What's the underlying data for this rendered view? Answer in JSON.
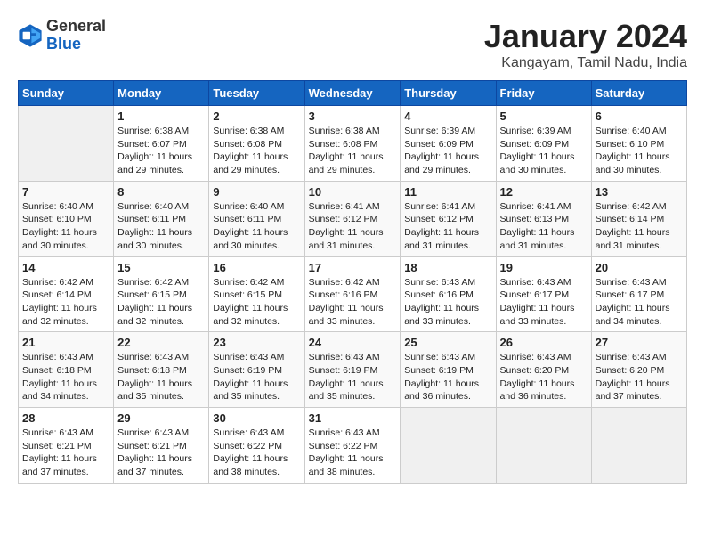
{
  "logo": {
    "line1": "General",
    "line2": "Blue"
  },
  "title": "January 2024",
  "subtitle": "Kangayam, Tamil Nadu, India",
  "days_header": [
    "Sunday",
    "Monday",
    "Tuesday",
    "Wednesday",
    "Thursday",
    "Friday",
    "Saturday"
  ],
  "weeks": [
    [
      {
        "day": "",
        "content": ""
      },
      {
        "day": "1",
        "content": "Sunrise: 6:38 AM\nSunset: 6:07 PM\nDaylight: 11 hours\nand 29 minutes."
      },
      {
        "day": "2",
        "content": "Sunrise: 6:38 AM\nSunset: 6:08 PM\nDaylight: 11 hours\nand 29 minutes."
      },
      {
        "day": "3",
        "content": "Sunrise: 6:38 AM\nSunset: 6:08 PM\nDaylight: 11 hours\nand 29 minutes."
      },
      {
        "day": "4",
        "content": "Sunrise: 6:39 AM\nSunset: 6:09 PM\nDaylight: 11 hours\nand 29 minutes."
      },
      {
        "day": "5",
        "content": "Sunrise: 6:39 AM\nSunset: 6:09 PM\nDaylight: 11 hours\nand 30 minutes."
      },
      {
        "day": "6",
        "content": "Sunrise: 6:40 AM\nSunset: 6:10 PM\nDaylight: 11 hours\nand 30 minutes."
      }
    ],
    [
      {
        "day": "7",
        "content": "Sunrise: 6:40 AM\nSunset: 6:10 PM\nDaylight: 11 hours\nand 30 minutes."
      },
      {
        "day": "8",
        "content": "Sunrise: 6:40 AM\nSunset: 6:11 PM\nDaylight: 11 hours\nand 30 minutes."
      },
      {
        "day": "9",
        "content": "Sunrise: 6:40 AM\nSunset: 6:11 PM\nDaylight: 11 hours\nand 30 minutes."
      },
      {
        "day": "10",
        "content": "Sunrise: 6:41 AM\nSunset: 6:12 PM\nDaylight: 11 hours\nand 31 minutes."
      },
      {
        "day": "11",
        "content": "Sunrise: 6:41 AM\nSunset: 6:12 PM\nDaylight: 11 hours\nand 31 minutes."
      },
      {
        "day": "12",
        "content": "Sunrise: 6:41 AM\nSunset: 6:13 PM\nDaylight: 11 hours\nand 31 minutes."
      },
      {
        "day": "13",
        "content": "Sunrise: 6:42 AM\nSunset: 6:14 PM\nDaylight: 11 hours\nand 31 minutes."
      }
    ],
    [
      {
        "day": "14",
        "content": "Sunrise: 6:42 AM\nSunset: 6:14 PM\nDaylight: 11 hours\nand 32 minutes."
      },
      {
        "day": "15",
        "content": "Sunrise: 6:42 AM\nSunset: 6:15 PM\nDaylight: 11 hours\nand 32 minutes."
      },
      {
        "day": "16",
        "content": "Sunrise: 6:42 AM\nSunset: 6:15 PM\nDaylight: 11 hours\nand 32 minutes."
      },
      {
        "day": "17",
        "content": "Sunrise: 6:42 AM\nSunset: 6:16 PM\nDaylight: 11 hours\nand 33 minutes."
      },
      {
        "day": "18",
        "content": "Sunrise: 6:43 AM\nSunset: 6:16 PM\nDaylight: 11 hours\nand 33 minutes."
      },
      {
        "day": "19",
        "content": "Sunrise: 6:43 AM\nSunset: 6:17 PM\nDaylight: 11 hours\nand 33 minutes."
      },
      {
        "day": "20",
        "content": "Sunrise: 6:43 AM\nSunset: 6:17 PM\nDaylight: 11 hours\nand 34 minutes."
      }
    ],
    [
      {
        "day": "21",
        "content": "Sunrise: 6:43 AM\nSunset: 6:18 PM\nDaylight: 11 hours\nand 34 minutes."
      },
      {
        "day": "22",
        "content": "Sunrise: 6:43 AM\nSunset: 6:18 PM\nDaylight: 11 hours\nand 35 minutes."
      },
      {
        "day": "23",
        "content": "Sunrise: 6:43 AM\nSunset: 6:19 PM\nDaylight: 11 hours\nand 35 minutes."
      },
      {
        "day": "24",
        "content": "Sunrise: 6:43 AM\nSunset: 6:19 PM\nDaylight: 11 hours\nand 35 minutes."
      },
      {
        "day": "25",
        "content": "Sunrise: 6:43 AM\nSunset: 6:19 PM\nDaylight: 11 hours\nand 36 minutes."
      },
      {
        "day": "26",
        "content": "Sunrise: 6:43 AM\nSunset: 6:20 PM\nDaylight: 11 hours\nand 36 minutes."
      },
      {
        "day": "27",
        "content": "Sunrise: 6:43 AM\nSunset: 6:20 PM\nDaylight: 11 hours\nand 37 minutes."
      }
    ],
    [
      {
        "day": "28",
        "content": "Sunrise: 6:43 AM\nSunset: 6:21 PM\nDaylight: 11 hours\nand 37 minutes."
      },
      {
        "day": "29",
        "content": "Sunrise: 6:43 AM\nSunset: 6:21 PM\nDaylight: 11 hours\nand 37 minutes."
      },
      {
        "day": "30",
        "content": "Sunrise: 6:43 AM\nSunset: 6:22 PM\nDaylight: 11 hours\nand 38 minutes."
      },
      {
        "day": "31",
        "content": "Sunrise: 6:43 AM\nSunset: 6:22 PM\nDaylight: 11 hours\nand 38 minutes."
      },
      {
        "day": "",
        "content": ""
      },
      {
        "day": "",
        "content": ""
      },
      {
        "day": "",
        "content": ""
      }
    ]
  ]
}
